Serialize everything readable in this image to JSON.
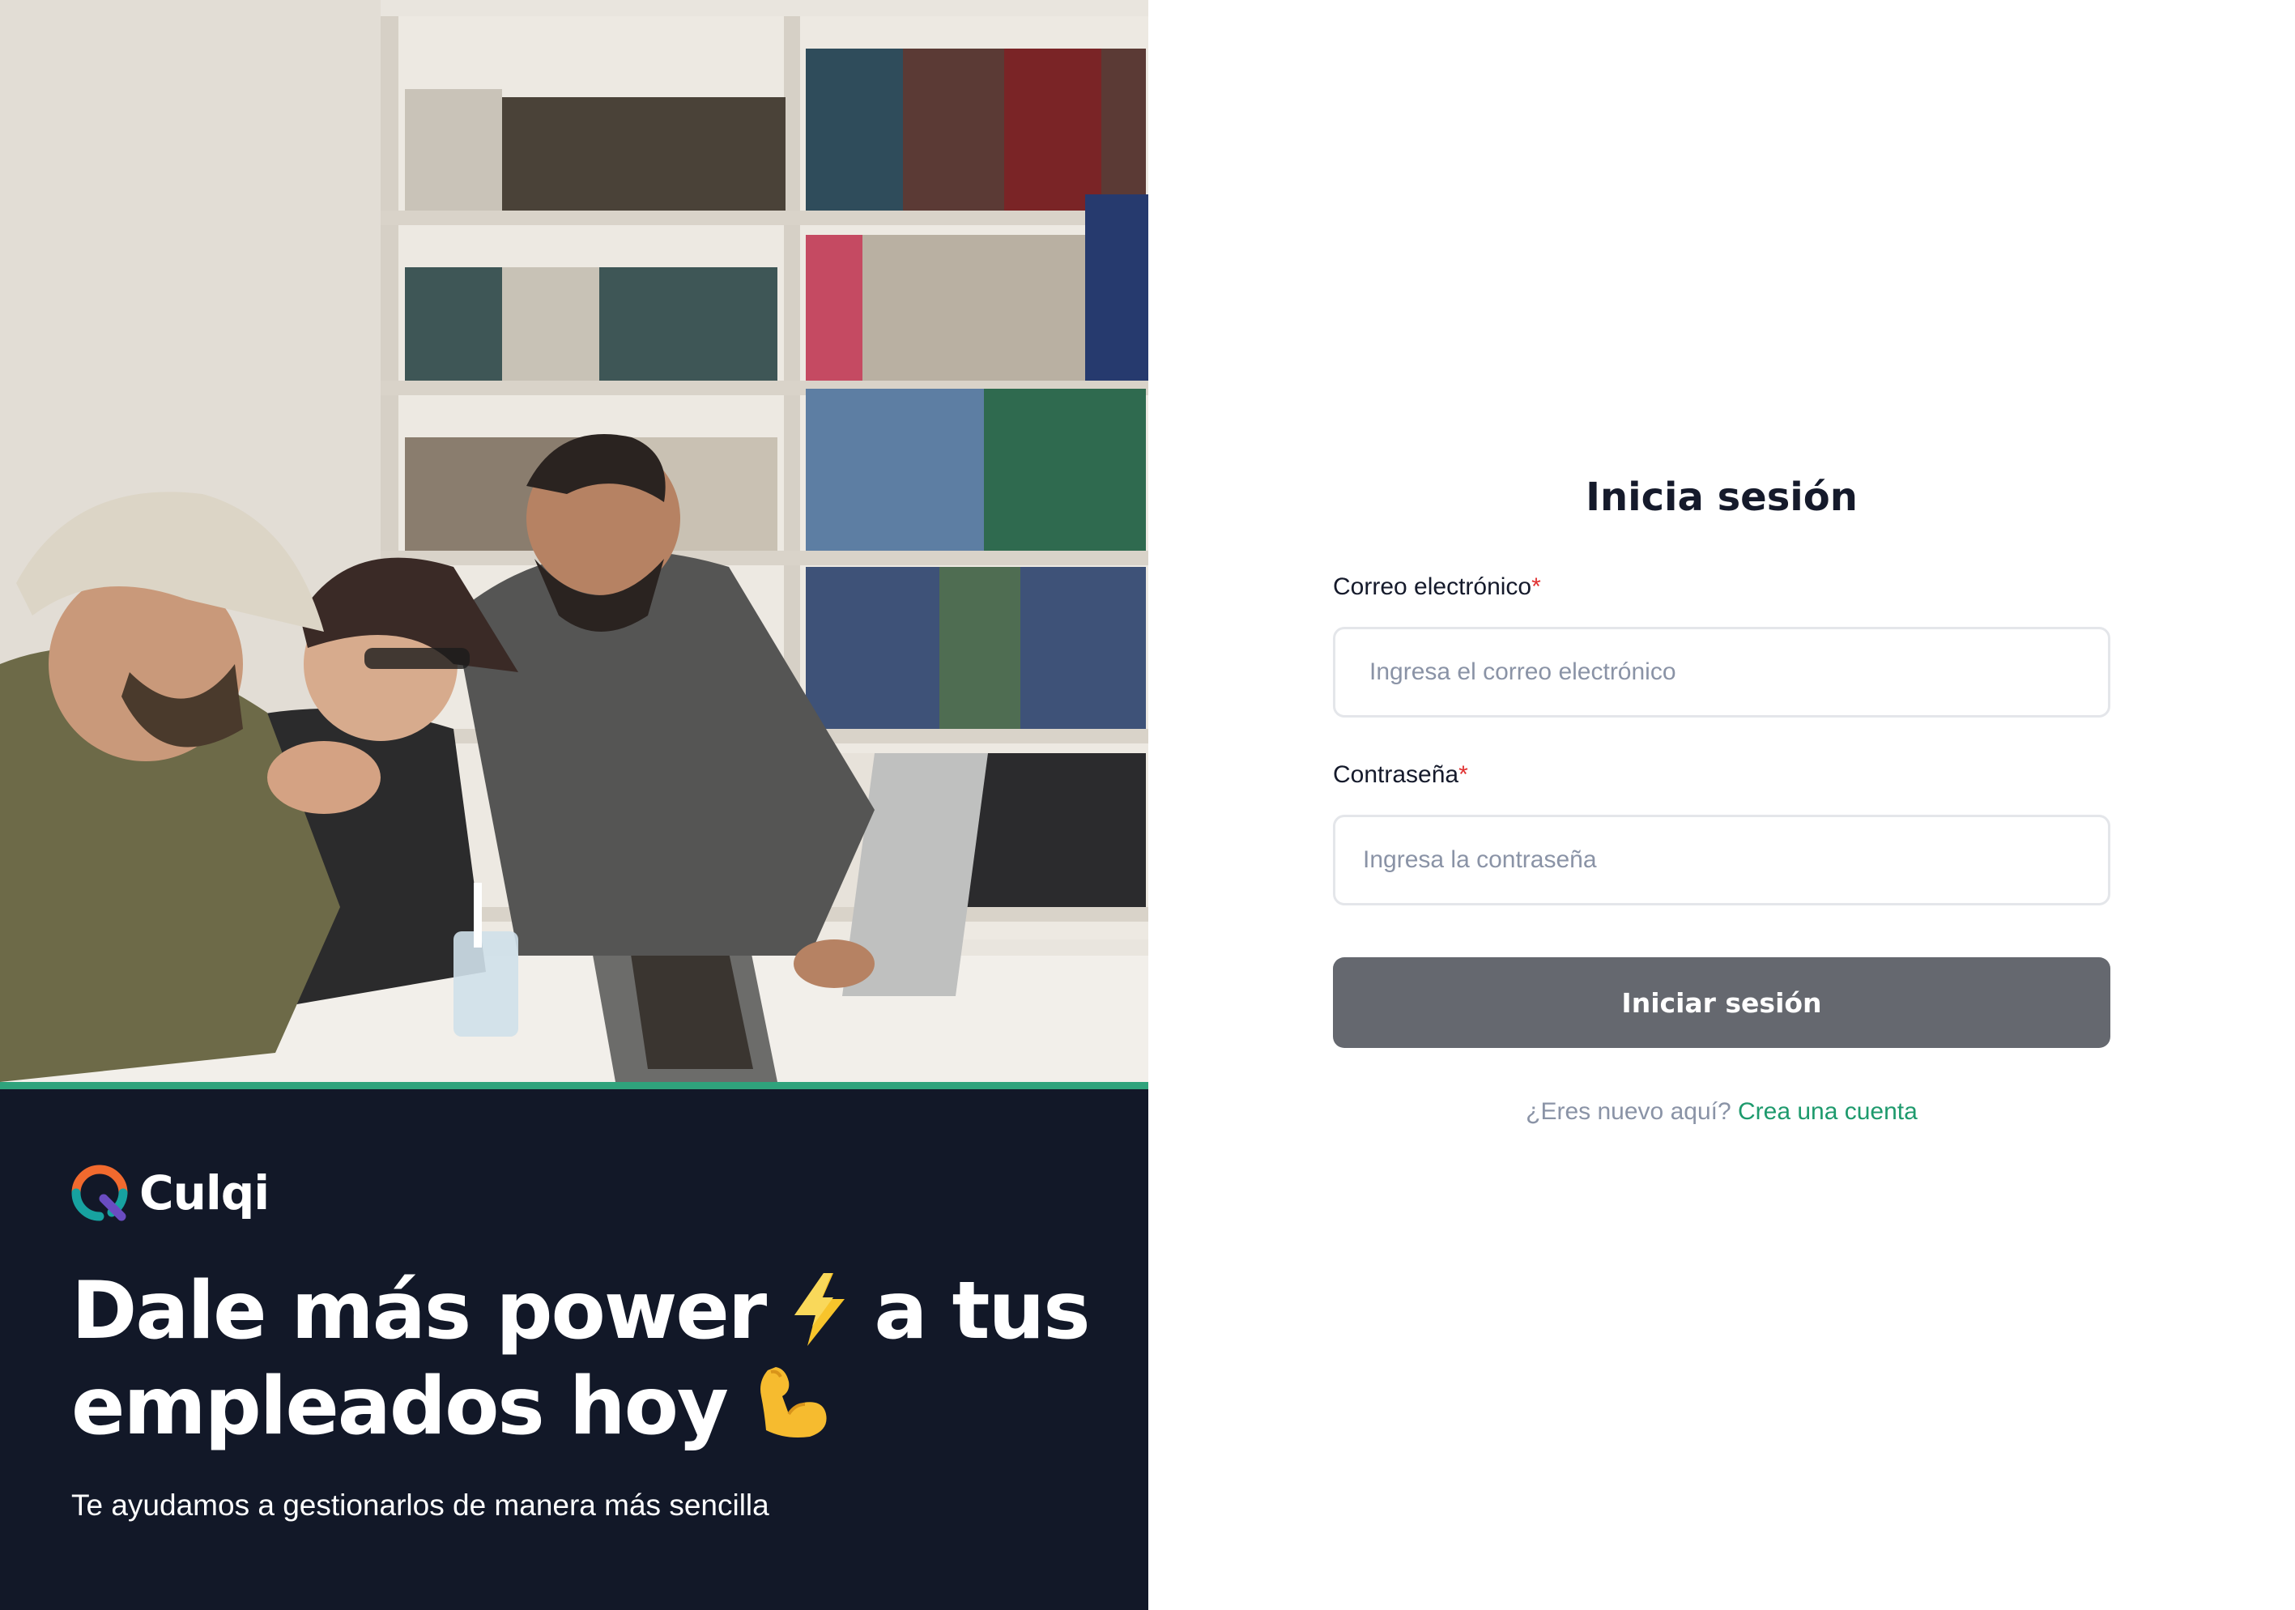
{
  "brand": {
    "name": "Culqi",
    "logo_icon": "culqi-logo-icon",
    "colors": {
      "orange": "#f26a2e",
      "teal": "#17a2a0",
      "purple": "#6a4cc2"
    }
  },
  "hero": {
    "image": "photo-students-laughing-at-laptop-in-library",
    "accent_color": "#2fa37c"
  },
  "promo": {
    "headline_part1": "Dale más power",
    "headline_part2": "a tus empleados hoy",
    "bolt_icon": "lightning-emoji-icon",
    "muscle_icon": "flexed-biceps-emoji-icon",
    "subtitle": "Te ayudamos a gestionarlos de manera más sencilla"
  },
  "login": {
    "title": "Inicia sesión",
    "email": {
      "label": "Correo electrónico",
      "required_mark": "*",
      "placeholder": "Ingresa el correo electrónico",
      "value": ""
    },
    "password": {
      "label": "Contraseña",
      "required_mark": "*",
      "placeholder": "Ingresa la contraseña",
      "value": ""
    },
    "submit_label": "Iniciar sesión",
    "signup_question": "¿Eres nuevo aquí?",
    "signup_link": "Crea una cuenta"
  },
  "colors": {
    "left_background": "#121828",
    "button_disabled": "#65686f",
    "link": "#1e9a6d",
    "required": "#e03131"
  }
}
